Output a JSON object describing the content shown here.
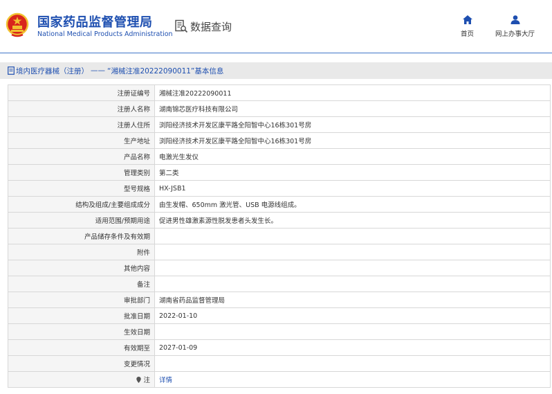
{
  "header": {
    "title_cn": "国家药品监督管理局",
    "title_en": "National Medical Products Administration",
    "query_label": "数据查询",
    "nav_home": "首页",
    "nav_hall": "网上办事大厅"
  },
  "breadcrumb": {
    "category": "境内医疗器械（注册）",
    "separator": "——",
    "suffix": "“湘械注准20222090011”基本信息"
  },
  "colors": {
    "brand_blue": "#1e4fb0",
    "emblem_red": "#d8261c",
    "emblem_gold": "#f2c230"
  },
  "icons": [
    "emblem-logo",
    "document-search-icon",
    "home-icon",
    "person-icon",
    "document-icon",
    "pin-icon"
  ],
  "rows": [
    {
      "label": "注册证编号",
      "value": "湘械注准20222090011"
    },
    {
      "label": "注册人名称",
      "value": "湖南锦芯医疗科技有限公司"
    },
    {
      "label": "注册人住所",
      "value": "浏阳经济技术开发区康平路全阳智中心16栋301号房"
    },
    {
      "label": "生产地址",
      "value": "浏阳经济技术开发区康平路全阳智中心16栋301号房"
    },
    {
      "label": "产品名称",
      "value": "电激光生发仪"
    },
    {
      "label": "管理类别",
      "value": "第二类"
    },
    {
      "label": "型号规格",
      "value": "HX-JSB1"
    },
    {
      "label": "结构及组成/主要组成成分",
      "value": "由生发帽、650mm 激光管、USB 电源线组成。"
    },
    {
      "label": "适用范围/预期用途",
      "value": "促进男性雄激素源性脱发患者头发生长。"
    },
    {
      "label": "产品储存条件及有效期",
      "value": ""
    },
    {
      "label": "附件",
      "value": ""
    },
    {
      "label": "其他内容",
      "value": ""
    },
    {
      "label": "备注",
      "value": ""
    },
    {
      "label": "审批部门",
      "value": "湖南省药品监督管理局"
    },
    {
      "label": "批准日期",
      "value": "2022-01-10"
    },
    {
      "label": "生效日期",
      "value": ""
    },
    {
      "label": "有效期至",
      "value": "2027-01-09"
    },
    {
      "label": "变更情况",
      "value": ""
    },
    {
      "label": "注",
      "value": "详情"
    }
  ]
}
